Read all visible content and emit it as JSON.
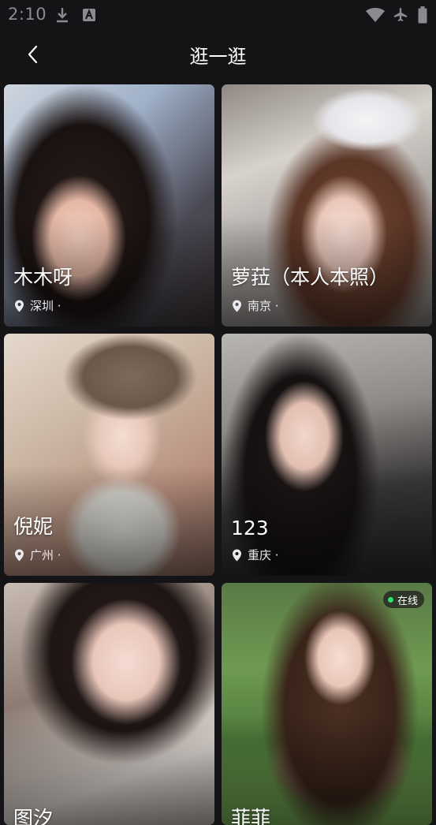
{
  "status_bar": {
    "time": "2:10",
    "icons": [
      "download-icon",
      "a-box-icon",
      "wifi-icon",
      "airplane-icon",
      "battery-icon"
    ]
  },
  "header": {
    "back_icon": "chevron-left-icon",
    "title": "逛一逛"
  },
  "cards": [
    {
      "name": "木木呀",
      "location": "深圳 ·",
      "online": false
    },
    {
      "name": "萝菈（本人本照）",
      "location": "南京 ·",
      "online": false
    },
    {
      "name": "倪妮",
      "location": "广州 ·",
      "online": false
    },
    {
      "name": "123",
      "location": "重庆 ·",
      "online": false
    },
    {
      "name": "图汐",
      "location": "",
      "online": false
    },
    {
      "name": "菲菲",
      "location": "",
      "online": true,
      "online_label": "在线"
    }
  ],
  "colors": {
    "background": "#141416",
    "online_dot": "#2ee26f"
  }
}
